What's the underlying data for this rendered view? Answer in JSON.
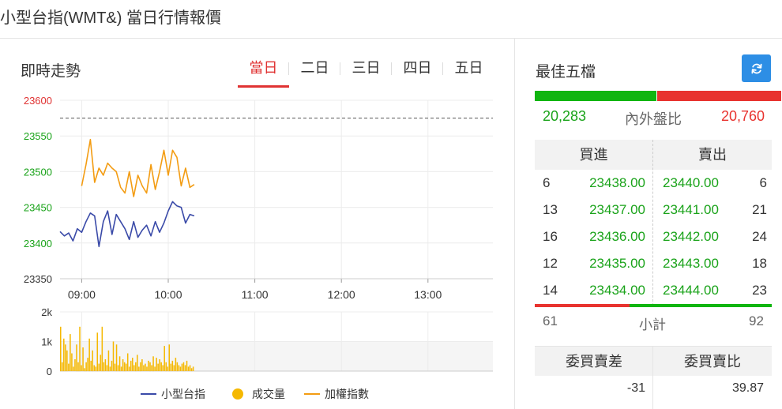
{
  "page": {
    "title": "小型台指(WMT&) 當日行情報價"
  },
  "left_panel": {
    "heading": "即時走勢",
    "tabs": [
      {
        "label": "當日",
        "active": true
      },
      {
        "label": "二日",
        "active": false
      },
      {
        "label": "三日",
        "active": false
      },
      {
        "label": "四日",
        "active": false
      },
      {
        "label": "五日",
        "active": false
      }
    ]
  },
  "chart_data": [
    {
      "type": "line",
      "x_axis": {
        "type": "time",
        "tick_labels": [
          "09:00",
          "10:00",
          "11:00",
          "12:00",
          "13:00"
        ],
        "range": [
          "08:45",
          "13:45"
        ]
      },
      "ylim": [
        23350,
        23600
      ],
      "y_tick_labels": [
        "23600",
        "23550",
        "23500",
        "23450",
        "23400",
        "23350"
      ],
      "y_tick_colors": [
        "#e03333",
        "#1aa31a",
        "#1aa31a",
        "#1aa31a",
        "#1aa31a",
        "#333333"
      ],
      "reference_line": 23575,
      "grid": true,
      "series": [
        {
          "name": "小型台指",
          "color": "#3a4aa8",
          "x": [
            "08:45",
            "08:48",
            "08:51",
            "08:54",
            "08:57",
            "09:00",
            "09:03",
            "09:06",
            "09:09",
            "09:12",
            "09:15",
            "09:18",
            "09:21",
            "09:24",
            "09:27",
            "09:30",
            "09:33",
            "09:36",
            "09:39",
            "09:42",
            "09:45",
            "09:48",
            "09:51",
            "09:54",
            "09:57",
            "10:00",
            "10:03",
            "10:06",
            "10:09",
            "10:12",
            "10:15",
            "10:18"
          ],
          "y": [
            23416,
            23410,
            23414,
            23403,
            23420,
            23415,
            23430,
            23442,
            23438,
            23395,
            23430,
            23445,
            23412,
            23440,
            23430,
            23420,
            23405,
            23430,
            23408,
            23418,
            23425,
            23410,
            23430,
            23415,
            23428,
            23445,
            23458,
            23452,
            23450,
            23428,
            23440,
            23438
          ]
        },
        {
          "name": "加權指數",
          "color": "#f39c12",
          "x": [
            "09:00",
            "09:03",
            "09:06",
            "09:09",
            "09:12",
            "09:15",
            "09:18",
            "09:21",
            "09:24",
            "09:27",
            "09:30",
            "09:33",
            "09:36",
            "09:39",
            "09:42",
            "09:45",
            "09:48",
            "09:51",
            "09:54",
            "09:57",
            "10:00",
            "10:03",
            "10:06",
            "10:09",
            "10:12",
            "10:15",
            "10:18"
          ],
          "y": [
            23480,
            23510,
            23545,
            23485,
            23505,
            23495,
            23512,
            23505,
            23500,
            23478,
            23470,
            23500,
            23465,
            23495,
            23480,
            23470,
            23510,
            23475,
            23500,
            23530,
            23495,
            23530,
            23520,
            23480,
            23505,
            23478,
            23482
          ]
        }
      ]
    },
    {
      "type": "bar",
      "name": "成交量",
      "color": "#f5b800",
      "x_range": [
        "08:45",
        "10:18"
      ],
      "ylim": [
        0,
        2000
      ],
      "y_tick_labels": [
        "2k",
        "1k",
        "0"
      ],
      "values": [
        1500,
        300,
        1100,
        900,
        700,
        250,
        1250,
        600,
        150,
        400,
        900,
        300,
        1500,
        200,
        800,
        100,
        300,
        450,
        1100,
        350,
        700,
        200,
        150,
        1300,
        250,
        550,
        1500,
        300,
        400,
        200,
        700,
        150,
        350,
        1000,
        250,
        900,
        200,
        500,
        150,
        400,
        300,
        250,
        600,
        150,
        350,
        450,
        200,
        300,
        550,
        150,
        300,
        400,
        200,
        250,
        150,
        350,
        300,
        200,
        500,
        150,
        450,
        250,
        400,
        300,
        200,
        850,
        300,
        150,
        900,
        250,
        350,
        200,
        450,
        300,
        200,
        150,
        250,
        300,
        200,
        350,
        150,
        200,
        100,
        150
      ]
    }
  ],
  "legend": [
    {
      "label": "小型台指",
      "color": "#3a4aa8",
      "icon": "line-marker"
    },
    {
      "label": "成交量",
      "color": "#f5b800",
      "icon": "circle-marker"
    },
    {
      "label": "加權指數",
      "color": "#f39c12",
      "icon": "line-marker"
    }
  ],
  "right_panel": {
    "title": "最佳五檔",
    "refresh_icon": "refresh-icon",
    "ratio": {
      "buy": "20,283",
      "label": "內外盤比",
      "sell": "20,760",
      "buy_fraction": 0.494
    },
    "orderbook": {
      "buy_header": "買進",
      "sell_header": "賣出",
      "rows": [
        {
          "bid_vol": "6",
          "bid": "23438.00",
          "ask": "23440.00",
          "ask_vol": "6"
        },
        {
          "bid_vol": "13",
          "bid": "23437.00",
          "ask": "23441.00",
          "ask_vol": "21"
        },
        {
          "bid_vol": "16",
          "bid": "23436.00",
          "ask": "23442.00",
          "ask_vol": "24"
        },
        {
          "bid_vol": "12",
          "bid": "23435.00",
          "ask": "23443.00",
          "ask_vol": "18"
        },
        {
          "bid_vol": "14",
          "bid": "23434.00",
          "ask": "23444.00",
          "ask_vol": "23"
        }
      ],
      "buy_total_fraction": 0.399
    },
    "subtotal": {
      "buy": "61",
      "label": "小計",
      "sell": "92"
    },
    "diff": {
      "header_1": "委買賣差",
      "header_2": "委買賣比",
      "value_1": "-31",
      "value_2": "39.87"
    },
    "colors": {
      "up": "#e8332f",
      "down": "#1aa31a",
      "accent": "#2d8ee5"
    }
  }
}
